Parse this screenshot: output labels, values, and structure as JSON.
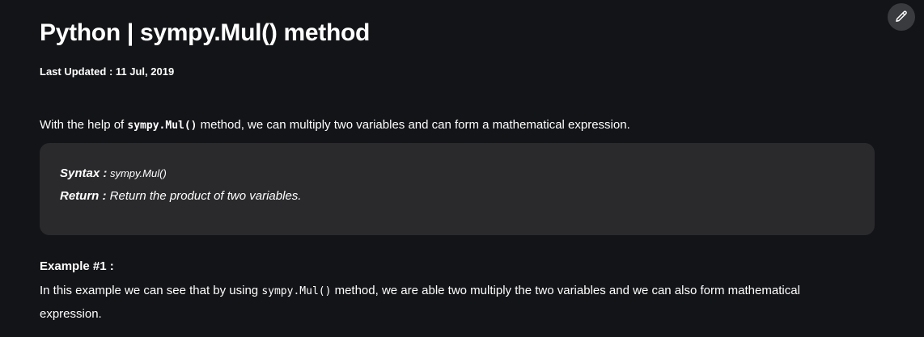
{
  "article": {
    "title": "Python | sympy.Mul() method",
    "last_updated": "Last Updated : 11 Jul, 2019",
    "intro": {
      "before": "With the help of ",
      "code": "sympy.Mul()",
      "after": " method, we can multiply two variables and can form a mathematical expression."
    },
    "syntax_box": {
      "syntax_label": "Syntax :",
      "syntax_value": " sympy.Mul()",
      "return_label": "Return :",
      "return_value": " Return the product of two variables."
    },
    "example": {
      "heading": "Example #1 :",
      "before": "In this example we can see that by using ",
      "code": "sympy.Mul()",
      "after": " method, we are able two multiply the two variables and we can also form mathematical expression."
    }
  },
  "toolbar": {
    "edit_icon": "pencil-icon"
  },
  "colors": {
    "background": "#131417",
    "box_background": "#2a2a2d",
    "edit_button": "#3a3b3f",
    "text": "#ffffff"
  }
}
